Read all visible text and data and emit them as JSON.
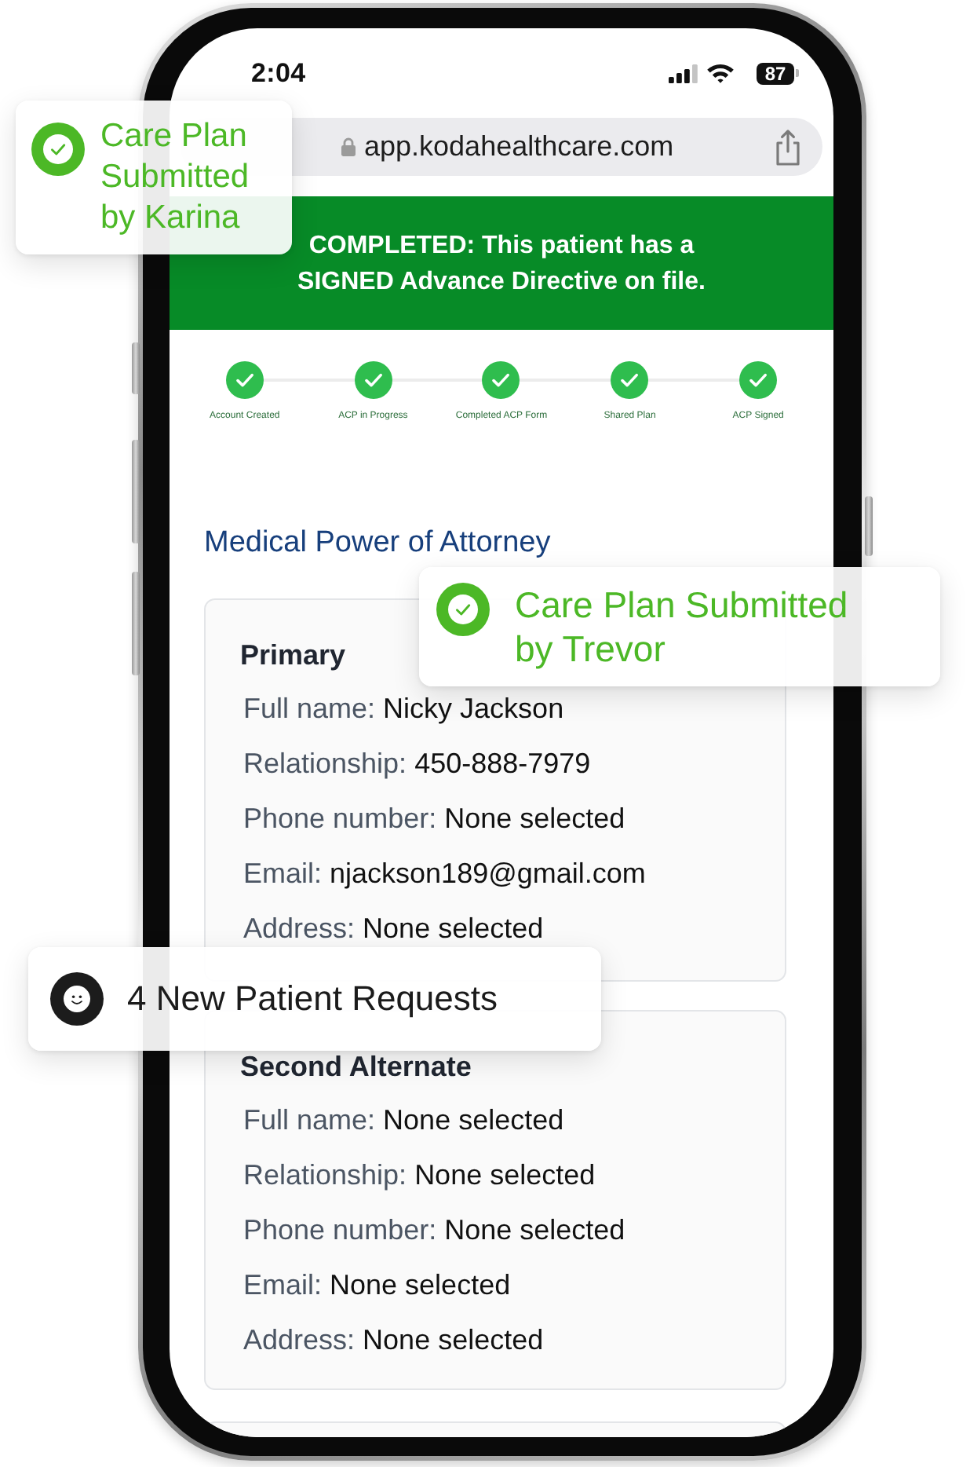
{
  "status_bar": {
    "time": "2:04",
    "battery": "87"
  },
  "browser": {
    "url": "app.kodahealthcare.com"
  },
  "banner": {
    "text": "COMPLETED: This patient has a SIGNED Advance Directive on file."
  },
  "progress_steps": [
    {
      "label": "Account Created",
      "done": true
    },
    {
      "label": "ACP in Progress",
      "done": true
    },
    {
      "label": "Completed ACP Form",
      "done": true
    },
    {
      "label": "Shared Plan",
      "done": true
    },
    {
      "label": "ACP Signed",
      "done": true
    }
  ],
  "section_title": "Medical Power of Attorney",
  "contacts": [
    {
      "heading": "Primary",
      "fields": [
        {
          "label": "Full name:",
          "value": "Nicky Jackson"
        },
        {
          "label": "Relationship:",
          "value": "450-888-7979"
        },
        {
          "label": "Phone number:",
          "value": "None selected"
        },
        {
          "label": "Email:",
          "value": "njackson189@gmail.com"
        },
        {
          "label": "Address:",
          "value": "None selected"
        }
      ]
    },
    {
      "heading": "Second Alternate",
      "fields": [
        {
          "label": "Full name:",
          "value": "None selected"
        },
        {
          "label": "Relationship:",
          "value": "None selected"
        },
        {
          "label": "Phone number:",
          "value": "None selected"
        },
        {
          "label": "Email:",
          "value": "None selected"
        },
        {
          "label": "Address:",
          "value": "None selected"
        }
      ]
    }
  ],
  "notifications": [
    {
      "kind": "success",
      "text": "Care Plan Submitted by Karina"
    },
    {
      "kind": "success",
      "text": "Care Plan Submitted by Trevor"
    },
    {
      "kind": "info",
      "text": "4 New Patient Requests"
    }
  ]
}
